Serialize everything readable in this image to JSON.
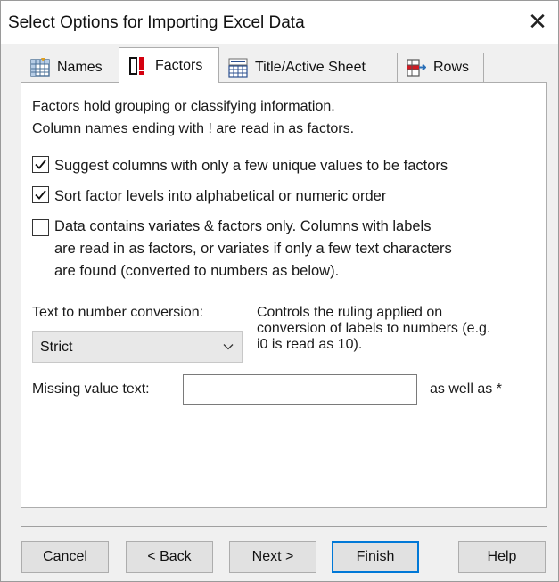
{
  "window": {
    "title": "Select Options for Importing Excel Data",
    "close_glyph": "✕"
  },
  "tabs": [
    {
      "label": "Names",
      "icon": "grid-icon"
    },
    {
      "label": "Factors",
      "icon": "factor-exclamation-icon",
      "active": true
    },
    {
      "label": "Title/Active Sheet",
      "icon": "title-sheet-icon"
    },
    {
      "label": "Rows",
      "icon": "rows-icon"
    }
  ],
  "factors_panel": {
    "info_line1": "Factors hold grouping or classifying information.",
    "info_line2": "Column names ending with ! are read in as factors.",
    "options": [
      {
        "label": "Suggest columns with only a few unique values to be factors",
        "checked": true
      },
      {
        "label": "Sort factor levels into alphabetical or numeric order",
        "checked": true
      },
      {
        "label_lines": [
          "Data contains variates & factors only. Columns with labels",
          "are read in as factors, or variates if only a few text characters",
          "are found (converted to numbers as below)."
        ],
        "checked": false
      }
    ],
    "conversion": {
      "label": "Text to number conversion:",
      "selected": "Strict",
      "description_lines": [
        "Controls the ruling applied on",
        "conversion of labels to numbers (e.g.",
        "i0 is read as 10)."
      ]
    },
    "missing_value": {
      "label": "Missing value text:",
      "value": "",
      "suffix": "as well as *"
    }
  },
  "buttons": {
    "cancel": "Cancel",
    "back": "< Back",
    "next": "Next >",
    "finish": "Finish",
    "help": "Help"
  },
  "colors": {
    "default_button_border": "#0078d7",
    "dialog_background": "#f0f0f0"
  }
}
